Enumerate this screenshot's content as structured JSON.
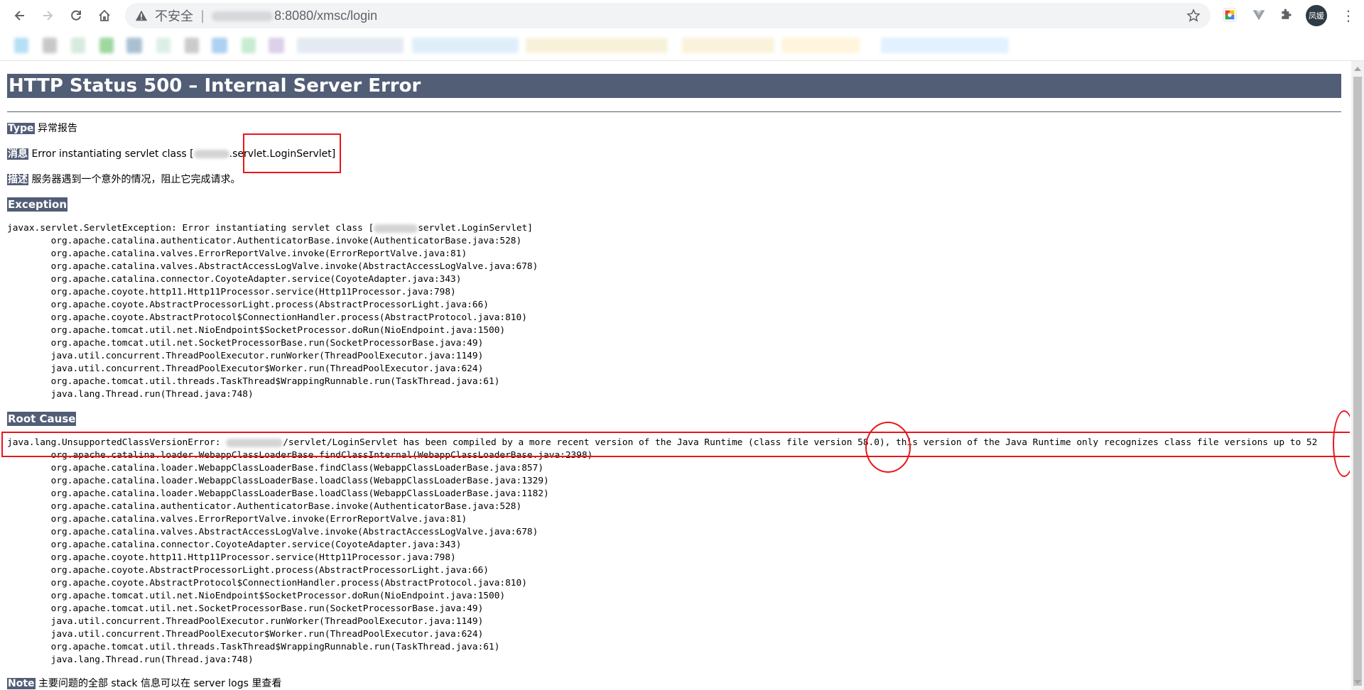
{
  "browser": {
    "url_security": "不安全",
    "url_text": "8:8080/xmsc/login",
    "avatar_label": "凤媛",
    "icons": [
      "back-icon",
      "forward-icon",
      "reload-icon",
      "home-icon",
      "warning-icon",
      "star-icon",
      "extension-icon",
      "puzzle-icon",
      "kebab-menu-icon"
    ]
  },
  "page": {
    "title": "HTTP Status 500 – Internal Server Error",
    "type_label": "Type",
    "type_value": "异常报告",
    "message_label": "消息",
    "message_prefix": "Error instantiating servlet class [",
    "message_suffix": ".servlet.LoginServlet]",
    "description_label": "描述",
    "description_value": "服务器遇到一个意外的情况，阻止它完成请求。",
    "exception_heading": "Exception",
    "exception_first_prefix": "javax.servlet.ServletException: Error instantiating servlet class [",
    "exception_first_suffix": "servlet.LoginServlet]",
    "exception_trace": [
      "        org.apache.catalina.authenticator.AuthenticatorBase.invoke(AuthenticatorBase.java:528)",
      "        org.apache.catalina.valves.ErrorReportValve.invoke(ErrorReportValve.java:81)",
      "        org.apache.catalina.valves.AbstractAccessLogValve.invoke(AbstractAccessLogValve.java:678)",
      "        org.apache.catalina.connector.CoyoteAdapter.service(CoyoteAdapter.java:343)",
      "        org.apache.coyote.http11.Http11Processor.service(Http11Processor.java:798)",
      "        org.apache.coyote.AbstractProcessorLight.process(AbstractProcessorLight.java:66)",
      "        org.apache.coyote.AbstractProtocol$ConnectionHandler.process(AbstractProtocol.java:810)",
      "        org.apache.tomcat.util.net.NioEndpoint$SocketProcessor.doRun(NioEndpoint.java:1500)",
      "        org.apache.tomcat.util.net.SocketProcessorBase.run(SocketProcessorBase.java:49)",
      "        java.util.concurrent.ThreadPoolExecutor.runWorker(ThreadPoolExecutor.java:1149)",
      "        java.util.concurrent.ThreadPoolExecutor$Worker.run(ThreadPoolExecutor.java:624)",
      "        org.apache.tomcat.util.threads.TaskThread$WrappingRunnable.run(TaskThread.java:61)",
      "        java.lang.Thread.run(Thread.java:748)"
    ],
    "root_cause_heading": "Root Cause",
    "root_first_prefix": "java.lang.UnsupportedClassVersionError: ",
    "root_first_suffix": "/servlet/LoginServlet has been compiled by a more recent version of the Java Runtime (class file version 58.0), this version of the Java Runtime only recognizes class file versions up to 52",
    "root_trace": [
      "        org.apache.catalina.loader.WebappClassLoaderBase.findClassInternal(WebappClassLoaderBase.java:2398)",
      "        org.apache.catalina.loader.WebappClassLoaderBase.findClass(WebappClassLoaderBase.java:857)",
      "        org.apache.catalina.loader.WebappClassLoaderBase.loadClass(WebappClassLoaderBase.java:1329)",
      "        org.apache.catalina.loader.WebappClassLoaderBase.loadClass(WebappClassLoaderBase.java:1182)",
      "        org.apache.catalina.authenticator.AuthenticatorBase.invoke(AuthenticatorBase.java:528)",
      "        org.apache.catalina.valves.ErrorReportValve.invoke(ErrorReportValve.java:81)",
      "        org.apache.catalina.valves.AbstractAccessLogValve.invoke(AbstractAccessLogValve.java:678)",
      "        org.apache.catalina.connector.CoyoteAdapter.service(CoyoteAdapter.java:343)",
      "        org.apache.coyote.http11.Http11Processor.service(Http11Processor.java:798)",
      "        org.apache.coyote.AbstractProcessorLight.process(AbstractProcessorLight.java:66)",
      "        org.apache.coyote.AbstractProtocol$ConnectionHandler.process(AbstractProtocol.java:810)",
      "        org.apache.tomcat.util.net.NioEndpoint$SocketProcessor.doRun(NioEndpoint.java:1500)",
      "        org.apache.tomcat.util.net.SocketProcessorBase.run(SocketProcessorBase.java:49)",
      "        java.util.concurrent.ThreadPoolExecutor.runWorker(ThreadPoolExecutor.java:1149)",
      "        java.util.concurrent.ThreadPoolExecutor$Worker.run(ThreadPoolExecutor.java:624)",
      "        org.apache.tomcat.util.threads.TaskThread$WrappingRunnable.run(TaskThread.java:61)",
      "        java.lang.Thread.run(Thread.java:748)"
    ],
    "note_label": "Note",
    "note_value": "主要问题的全部 stack 信息可以在 server logs 里查看"
  },
  "colors": {
    "heading_bg": "#525d76",
    "annotation": "#e8161b"
  }
}
